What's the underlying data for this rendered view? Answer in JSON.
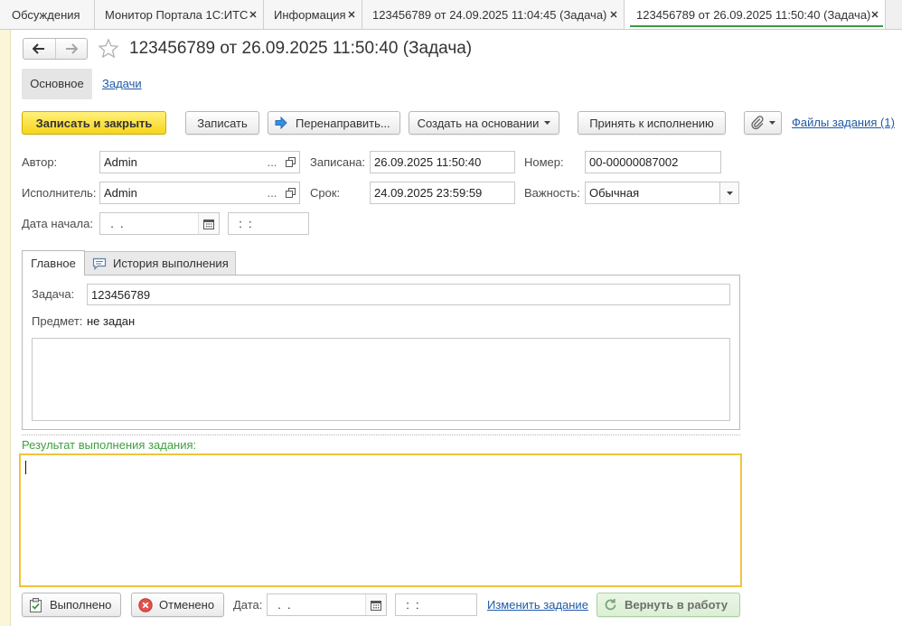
{
  "window_tabs": [
    {
      "label": "Обсуждения"
    },
    {
      "label": "Монитор Портала 1С:ИТС"
    },
    {
      "label": "Информация"
    },
    {
      "label": "123456789 от 24.09.2025 11:04:45 (Задача)"
    },
    {
      "label": "123456789 от 26.09.2025 11:50:40 (Задача)",
      "active": true
    }
  ],
  "header": {
    "title": "123456789 от 26.09.2025 11:50:40 (Задача)",
    "icons": {
      "back": "arrow-left-icon",
      "forward": "arrow-right-icon",
      "favorite": "star-icon"
    }
  },
  "sections": {
    "main": "Основное",
    "tasks": "Задачи"
  },
  "toolbar": {
    "save_and_close": "Записать и закрыть",
    "save": "Записать",
    "redirect": "Перенаправить...",
    "create_based_on": "Создать на основании",
    "accept": "Принять к исполнению",
    "files_link": "Файлы задания (1)"
  },
  "form": {
    "author": {
      "label": "Автор:",
      "value": "Admin"
    },
    "recorded": {
      "label": "Записана:",
      "value": "26.09.2025 11:50:40"
    },
    "number": {
      "label": "Номер:",
      "value": "00-00000087002"
    },
    "executor": {
      "label": "Исполнитель:",
      "value": "Admin"
    },
    "deadline": {
      "label": "Срок:",
      "value": "24.09.2025 23:59:59"
    },
    "importance": {
      "label": "Важность:",
      "value": "Обычная"
    },
    "start_date": {
      "label": "Дата начала:",
      "date": "  .  .",
      "time": "  :  :"
    },
    "choose_button": "..."
  },
  "inner_tabs": [
    {
      "label": "Главное",
      "active": true
    },
    {
      "label": "История выполнения",
      "icon": "comment-icon"
    }
  ],
  "main_tab": {
    "task": {
      "label": "Задача:",
      "value": "123456789"
    },
    "subject": {
      "label": "Предмет:",
      "value": "не задан"
    }
  },
  "result": {
    "label": "Результат выполнения задания:"
  },
  "footer": {
    "done": "Выполнено",
    "cancelled": "Отменено",
    "date": {
      "label": "Дата:",
      "date": "  .  .",
      "time": "  :  :"
    },
    "change_task": "Изменить задание",
    "return_to_work": "Вернуть в работу"
  },
  "colors": {
    "primary_button": "#f7d51d",
    "link": "#1f5aa8",
    "result_label": "#3f9f3f",
    "focus_border": "#f0c43a",
    "active_tab_underline": "#3e9a47",
    "return_button": "#dcefd6"
  }
}
